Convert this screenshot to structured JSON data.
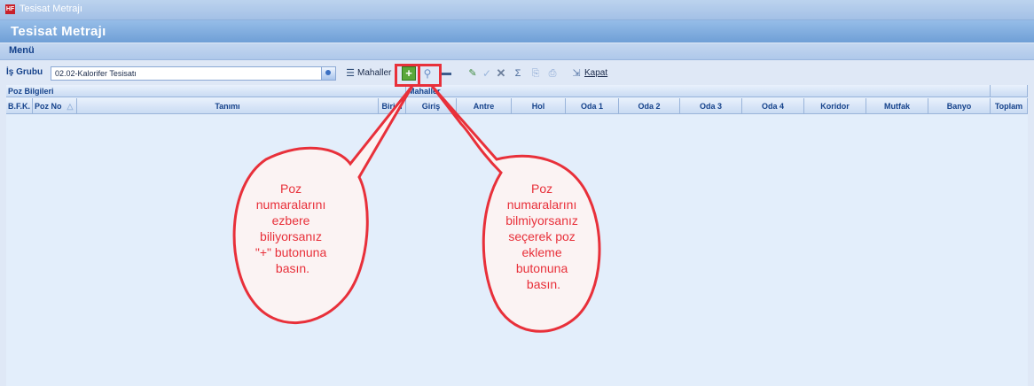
{
  "window": {
    "title": "Tesisat Metrajı",
    "icon_text": "HF"
  },
  "header": {
    "title": "Tesisat Metrajı"
  },
  "menu": {
    "label": "Menü"
  },
  "toolbar": {
    "is_grubu_label": "İş Grubu",
    "is_grubu_value": "02.02-Kalorifer Tesisatı",
    "mahaller_label": "Mahaller",
    "kapat_label": "Kapat"
  },
  "grid": {
    "group_poz": "Poz Bilgileri",
    "group_mahaller": "Mahaller",
    "columns": {
      "bfk": "B.F.K.",
      "poz_no": "Poz No",
      "tanimi": "Tanımı",
      "birim": "Birim",
      "giris": "Giriş",
      "antre": "Antre",
      "hol": "Hol",
      "oda1": "Oda 1",
      "oda2": "Oda 2",
      "oda3": "Oda 3",
      "oda4": "Oda 4",
      "koridor": "Koridor",
      "mutfak": "Mutfak",
      "banyo": "Banyo",
      "toplam": "Toplam"
    }
  },
  "callouts": {
    "left": [
      "Poz",
      "numaralarını",
      "ezbere",
      "biliyorsanız",
      "\"+\" butonuna",
      "basın."
    ],
    "right": [
      "Poz",
      "numaralarını",
      "bilmiyorsanız",
      "seçerek poz",
      "ekleme",
      "butonuna",
      "basın."
    ]
  },
  "colors": {
    "callout_red": "#e8303a",
    "header_blue": "#15428b"
  }
}
